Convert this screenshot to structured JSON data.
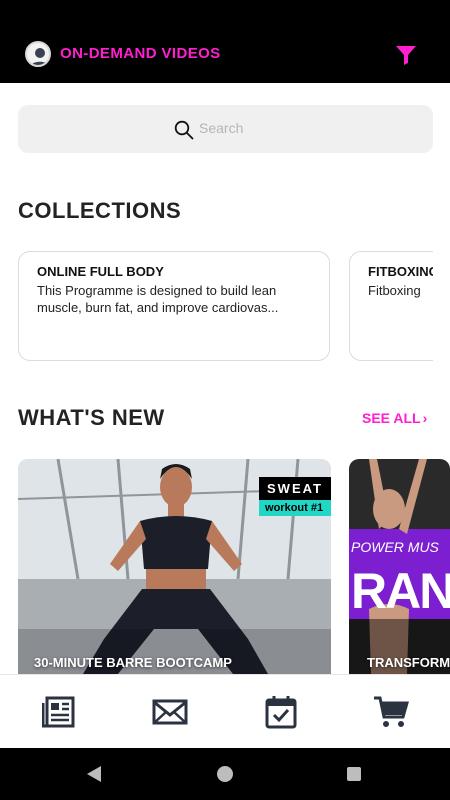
{
  "header": {
    "title": "ON-DEMAND VIDEOS",
    "accent": "#ff1fd0",
    "left_icon": "avatar-icon",
    "right_icon": "filter-icon"
  },
  "search": {
    "placeholder": "Search",
    "icon": "search-icon"
  },
  "collections": {
    "title": "COLLECTIONS",
    "items": [
      {
        "title": "ONLINE FULL BODY",
        "description": "This Programme is designed to build lean muscle, burn fat, and improve cardiovas..."
      },
      {
        "title": "FITBOXING",
        "description": "Fitboxing"
      }
    ]
  },
  "whats_new": {
    "title": "WHAT'S NEW",
    "see_all": "SEE ALL",
    "items": [
      {
        "title": "30-MINUTE BARRE BOOTCAMP",
        "badge_top": "SWEAT",
        "badge_bottom": "workout #1"
      },
      {
        "title": "TRANSFORM",
        "overlay_line1": "POWER MUS",
        "overlay_line2": "RAN"
      }
    ]
  },
  "bottom_nav": {
    "items": [
      {
        "icon": "newspaper-icon"
      },
      {
        "icon": "mail-icon"
      },
      {
        "icon": "calendar-check-icon"
      },
      {
        "icon": "cart-icon"
      }
    ]
  },
  "system_nav": {
    "items": [
      "back-icon",
      "home-icon",
      "recents-icon"
    ]
  }
}
